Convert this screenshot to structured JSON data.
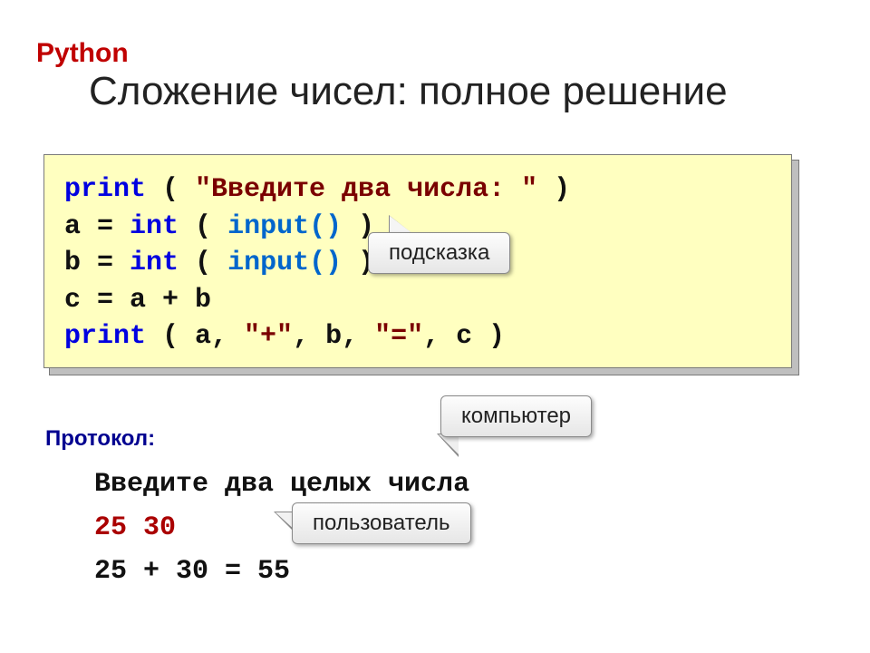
{
  "header": {
    "lang_label": "Python",
    "title": "Сложение чисел: полное решение"
  },
  "code": {
    "l1_print": "print",
    "l1_open": " ( ",
    "l1_str": "\"Введите два числа: \"",
    "l1_close": " )",
    "l2_a": "a",
    "l2_eq": " = ",
    "l2_int": "int",
    "l2_open": " ( ",
    "l2_input": "input()",
    "l2_close": " )",
    "l3_b": "b",
    "l3_eq": " = ",
    "l3_int": "int",
    "l3_open": " ( ",
    "l3_input": "input()",
    "l3_close": " )",
    "l4": "c = a + b",
    "l5_print": "print",
    "l5_open": " ( a, ",
    "l5_s1": "\"+\"",
    "l5_mid": ", b, ",
    "l5_s2": "\"=\"",
    "l5_close": ", c )"
  },
  "callouts": {
    "hint": "подсказка",
    "computer": "компьютер",
    "user": "пользователь"
  },
  "protocol": {
    "label": "Протокол:",
    "line1": "Введите два целых числа",
    "line2": "25 30",
    "line3": "25 + 30 = 55"
  }
}
